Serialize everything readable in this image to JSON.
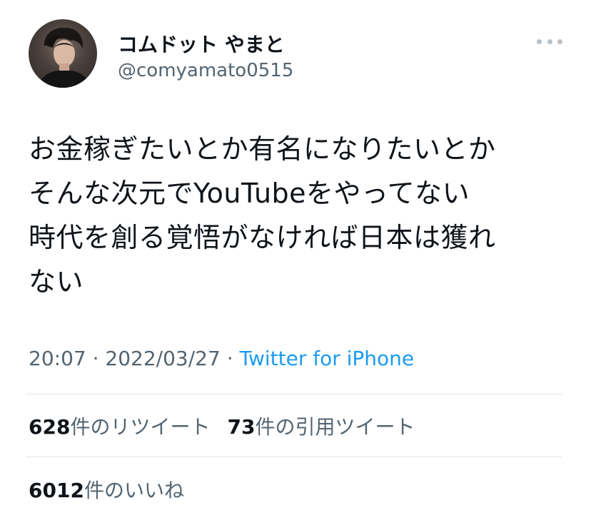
{
  "author": {
    "display_name": "コムドット やまと",
    "handle": "@comyamato0515",
    "avatar": "profile-photo"
  },
  "menu_icon": "more-horizontal-icon",
  "tweet": {
    "lines": [
      "お金稼ぎたいとか有名になりたいとか",
      "そんな次元でYouTubeをやってない",
      "時代を創る覚悟がなければ日本は獲れ",
      "ない"
    ]
  },
  "meta": {
    "time": "20:07",
    "separator1": " · ",
    "date": "2022/03/27",
    "separator2": " · ",
    "source": "Twitter for iPhone"
  },
  "stats": {
    "retweets_count": "628",
    "retweets_label": "件のリツイート",
    "quotes_count": "73",
    "quotes_label": "件の引用ツイート",
    "likes_count": "6012",
    "likes_label": "件のいいね"
  },
  "colors": {
    "text": "#0f1419",
    "secondary": "#536471",
    "link": "#1d9bf0",
    "divider": "#e1e4e7"
  }
}
